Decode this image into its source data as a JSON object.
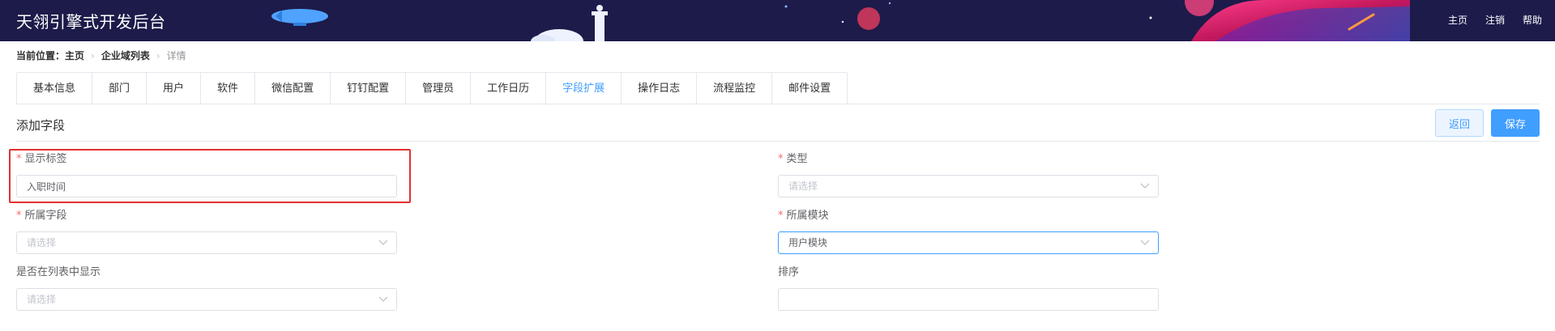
{
  "app": {
    "title": "天翎引擎式开发后台"
  },
  "header_nav": [
    {
      "label": "主页"
    },
    {
      "label": "注销"
    },
    {
      "label": "帮助"
    }
  ],
  "breadcrumb": {
    "prefix": "当前位置：",
    "items": [
      "主页",
      "企业域列表",
      "详情"
    ]
  },
  "tabs": [
    "基本信息",
    "部门",
    "用户",
    "软件",
    "微信配置",
    "钉钉配置",
    "管理员",
    "工作日历",
    "字段扩展",
    "操作日志",
    "流程监控",
    "邮件设置"
  ],
  "active_tab": "字段扩展",
  "section": {
    "title": "添加字段",
    "back_label": "返回",
    "save_label": "保存"
  },
  "form": {
    "display_label": {
      "label": "显示标签",
      "required": true,
      "value": "入职时间"
    },
    "type": {
      "label": "类型",
      "required": true,
      "placeholder": "请选择"
    },
    "field": {
      "label": "所属字段",
      "required": true,
      "placeholder": "请选择"
    },
    "module": {
      "label": "所属模块",
      "required": true,
      "value": "用户模块"
    },
    "show_in_list": {
      "label": "是否在列表中显示",
      "required": false,
      "placeholder": "请选择"
    },
    "sort": {
      "label": "排序",
      "required": false,
      "value": ""
    }
  },
  "colors": {
    "header_bg": "#1d1b4a",
    "accent": "#409eff",
    "required": "#f56c6c",
    "highlight": "#e03131"
  }
}
